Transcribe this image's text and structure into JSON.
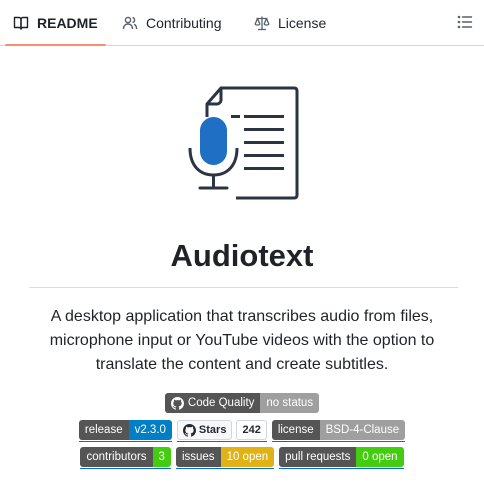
{
  "tabs": [
    {
      "label": "README",
      "icon": "book-icon",
      "active": true
    },
    {
      "label": "Contributing",
      "icon": "people-icon",
      "active": false
    },
    {
      "label": "License",
      "icon": "law-icon",
      "active": false
    }
  ],
  "toc_icon": "list-unordered-icon",
  "logo_icon": "document-microphone-icon",
  "title": "Audiotext",
  "description": "A desktop application that transcribes audio from files, microphone input or YouTube videos with the option to translate the content and create subtitles.",
  "badges": {
    "code_quality": {
      "label": "Code Quality",
      "value": "no status",
      "value_color": "#9f9f9f"
    },
    "release": {
      "label": "release",
      "value": "v2.3.0",
      "value_color": "#007ec6"
    },
    "stars": {
      "label": "Stars",
      "count": "242"
    },
    "license": {
      "label": "license",
      "value": "BSD-4-Clause",
      "value_color": "#9f9f9f"
    },
    "contributors": {
      "label": "contributors",
      "value": "3",
      "value_color": "#4c1"
    },
    "issues": {
      "label": "issues",
      "value": "10 open",
      "value_color": "#dfb317"
    },
    "pull_requests": {
      "label": "pull requests",
      "value": "0 open",
      "value_color": "#4c1"
    }
  },
  "colors": {
    "tab_underline": "#fd8c73",
    "badge_label": "#555555",
    "logo_blue": "#1f6fc4",
    "logo_dark": "#2b3442"
  }
}
